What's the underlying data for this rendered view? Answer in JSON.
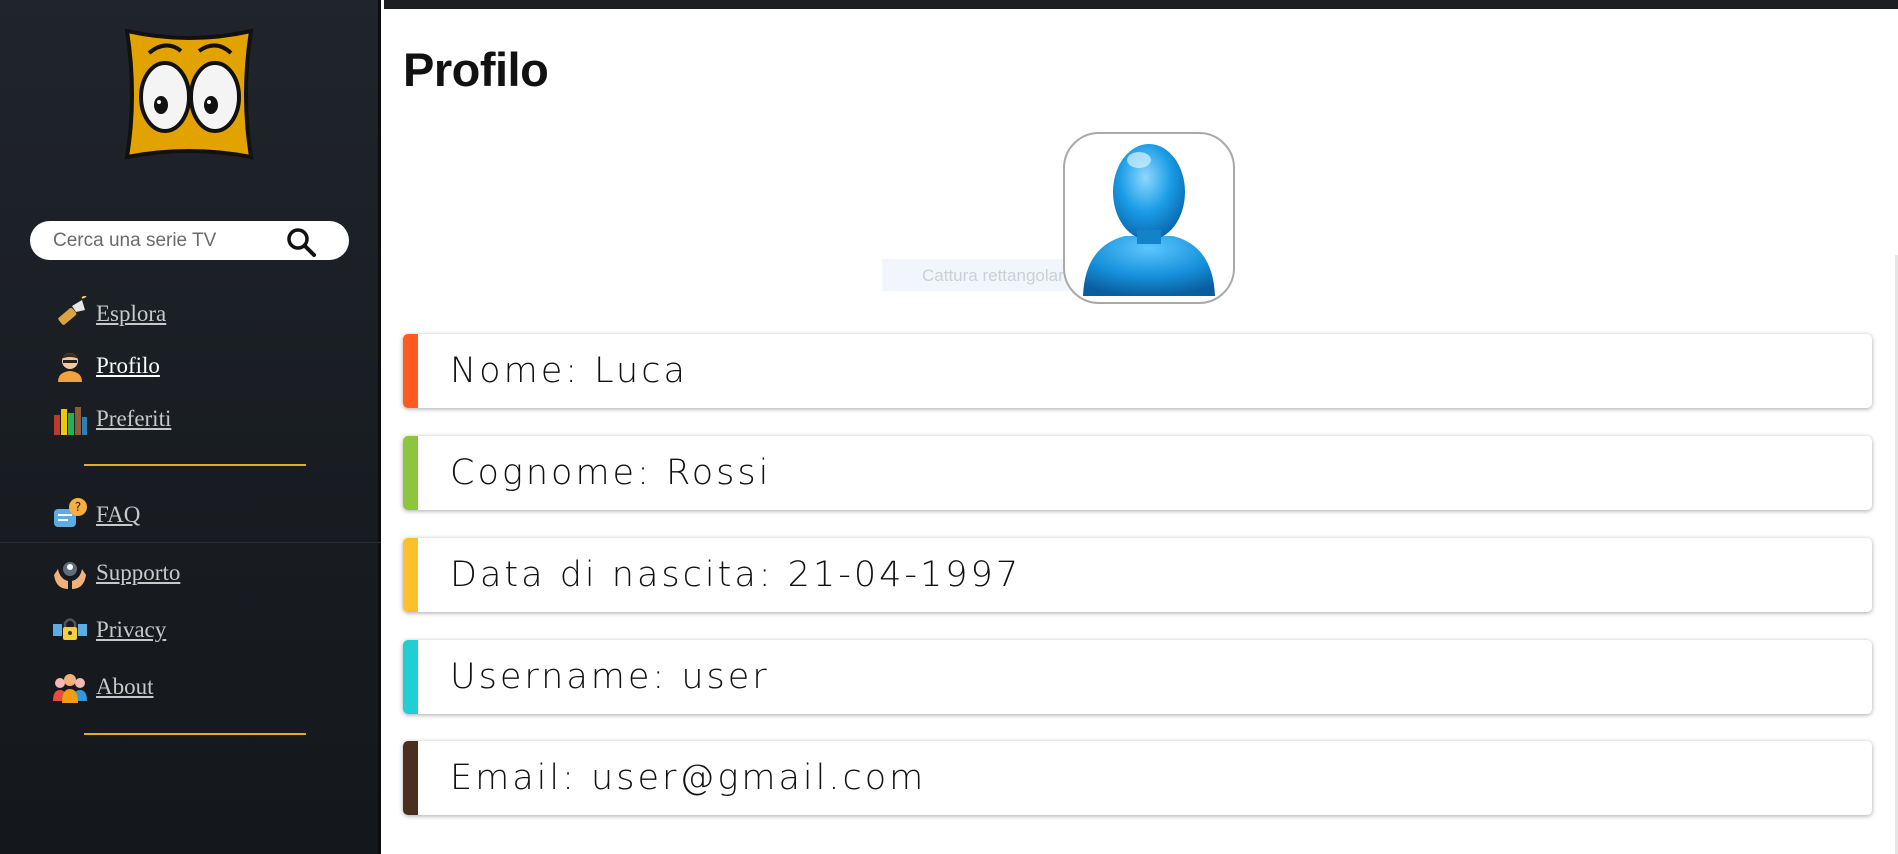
{
  "sidebar": {
    "logo": "cartoon-eyes-logo",
    "search": {
      "placeholder": "Cerca una serie TV",
      "value": ""
    },
    "nav_primary": [
      {
        "label": "Esplora",
        "icon": "flashlight-icon"
      },
      {
        "label": "Profilo",
        "icon": "user-avatar-icon",
        "active": true
      },
      {
        "label": "Preferiti",
        "icon": "books-icon"
      }
    ],
    "nav_secondary": [
      {
        "label": "FAQ",
        "icon": "faq-chat-icon"
      },
      {
        "label": "Supporto",
        "icon": "support-hands-icon"
      },
      {
        "label": "Privacy",
        "icon": "privacy-lock-icon"
      },
      {
        "label": "About",
        "icon": "team-icon"
      }
    ],
    "divider_color": "#e0b020"
  },
  "main": {
    "title": "Profilo",
    "avatar": "default-user-avatar",
    "tooltip_text": "Cattura rettangolare",
    "fields": [
      {
        "label": "Nome: Luca",
        "accent": "#ff5a1f"
      },
      {
        "label": "Cognome: Rossi",
        "accent": "#8cc63f"
      },
      {
        "label": "Data di nascita: 21-04-1997",
        "accent": "#fcc02c"
      },
      {
        "label": "Username: user",
        "accent": "#1fcfd3"
      },
      {
        "label": "Email: user@gmail.com",
        "accent": "#4a2e20"
      }
    ]
  }
}
